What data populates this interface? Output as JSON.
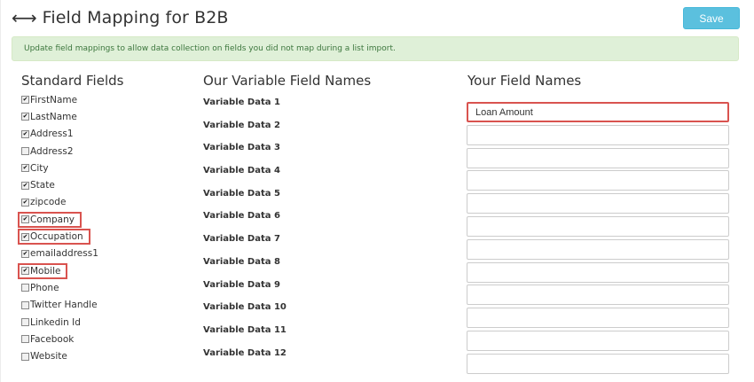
{
  "header": {
    "icon": "left-right-arrow-icon",
    "title": "Field Mapping for B2B",
    "save_label": "Save"
  },
  "alert": {
    "text": "Update field mappings to allow data collection on fields you did not map during a list import."
  },
  "columns": {
    "standard": "Standard Fields",
    "variable": "Our Variable Field Names",
    "yours": "Your Field Names"
  },
  "standard_fields": [
    {
      "label": "FirstName",
      "checked": true,
      "highlighted": false
    },
    {
      "label": "LastName",
      "checked": true,
      "highlighted": false
    },
    {
      "label": "Address1",
      "checked": true,
      "highlighted": false
    },
    {
      "label": "Address2",
      "checked": false,
      "highlighted": false
    },
    {
      "label": "City",
      "checked": true,
      "highlighted": false
    },
    {
      "label": "State",
      "checked": true,
      "highlighted": false
    },
    {
      "label": "zipcode",
      "checked": true,
      "highlighted": false
    },
    {
      "label": "Company",
      "checked": true,
      "highlighted": true
    },
    {
      "label": "Occupation",
      "checked": true,
      "highlighted": true
    },
    {
      "label": "emailaddress1",
      "checked": true,
      "highlighted": false
    },
    {
      "label": "Mobile",
      "checked": true,
      "highlighted": true
    },
    {
      "label": "Phone",
      "checked": false,
      "highlighted": false
    },
    {
      "label": "Twitter Handle",
      "checked": false,
      "highlighted": false
    },
    {
      "label": "Linkedin Id",
      "checked": false,
      "highlighted": false
    },
    {
      "label": "Facebook",
      "checked": false,
      "highlighted": false
    },
    {
      "label": "Website",
      "checked": false,
      "highlighted": false
    }
  ],
  "variable_fields": [
    "Variable Data 1",
    "Variable Data 2",
    "Variable Data 3",
    "Variable Data 4",
    "Variable Data 5",
    "Variable Data 6",
    "Variable Data 7",
    "Variable Data 8",
    "Variable Data 9",
    "Variable Data 10",
    "Variable Data 11",
    "Variable Data 12"
  ],
  "your_fields": [
    {
      "value": "Loan Amount",
      "highlighted": true
    },
    {
      "value": "",
      "highlighted": false
    },
    {
      "value": "",
      "highlighted": false
    },
    {
      "value": "",
      "highlighted": false
    },
    {
      "value": "",
      "highlighted": false
    },
    {
      "value": "",
      "highlighted": false
    },
    {
      "value": "",
      "highlighted": false
    },
    {
      "value": "",
      "highlighted": false
    },
    {
      "value": "",
      "highlighted": false
    },
    {
      "value": "",
      "highlighted": false
    },
    {
      "value": "",
      "highlighted": false
    },
    {
      "value": "",
      "highlighted": false
    }
  ],
  "colors": {
    "save_button": "#5bc0de",
    "alert_bg": "#dff0d8",
    "alert_text": "#3c763d",
    "highlight_border": "#d9534f"
  }
}
